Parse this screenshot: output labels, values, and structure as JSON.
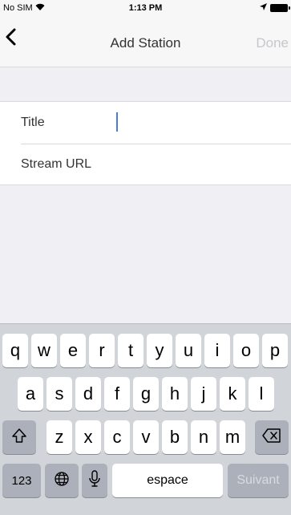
{
  "status_bar": {
    "carrier": "No SIM",
    "time": "1:13 PM"
  },
  "nav": {
    "title": "Add Station",
    "done_label": "Done"
  },
  "form": {
    "title_label": "Title",
    "stream_url_label": "Stream URL",
    "title_value": "",
    "stream_url_value": ""
  },
  "keyboard": {
    "row1": [
      "q",
      "w",
      "e",
      "r",
      "t",
      "y",
      "u",
      "i",
      "o",
      "p"
    ],
    "row2": [
      "a",
      "s",
      "d",
      "f",
      "g",
      "h",
      "j",
      "k",
      "l"
    ],
    "row3": [
      "z",
      "x",
      "c",
      "v",
      "b",
      "n",
      "m"
    ],
    "numbers_key": "123",
    "space_key": "espace",
    "return_key": "Suivant"
  },
  "colors": {
    "accent": "#4a7bd8",
    "done_disabled": "#c7c7cc",
    "background": "#efeff4",
    "keyboard_bg": "#d1d4d9"
  }
}
